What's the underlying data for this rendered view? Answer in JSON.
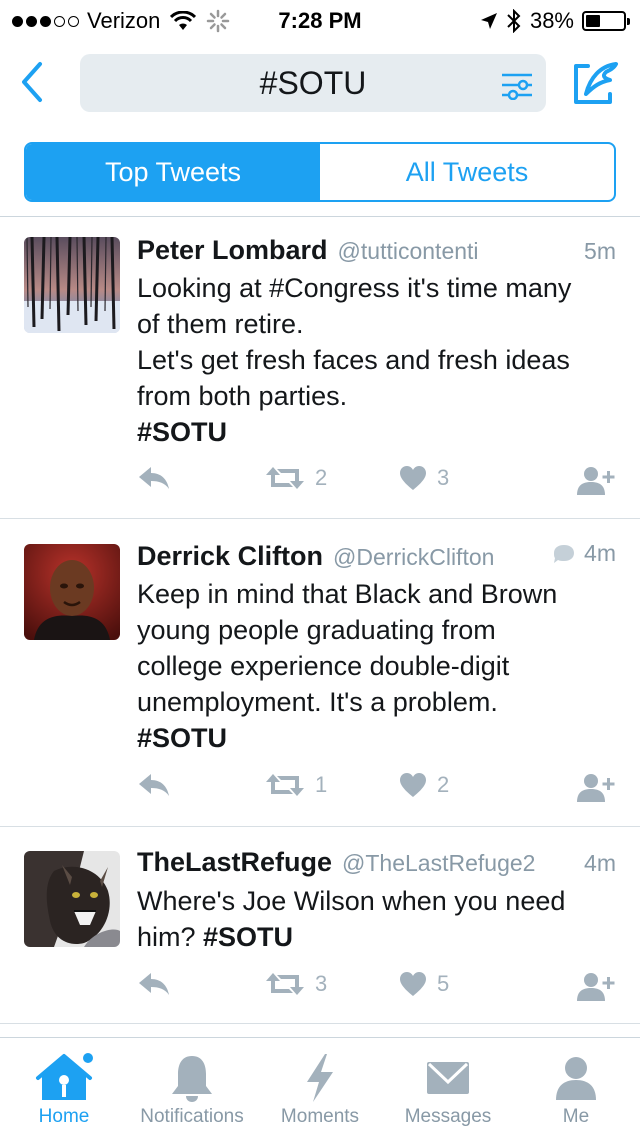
{
  "status_bar": {
    "carrier": "Verizon",
    "time": "7:28 PM",
    "battery": "38%",
    "battery_level": 0.38
  },
  "search": {
    "query": "#SOTU"
  },
  "segments": [
    {
      "label": "Top Tweets",
      "active": true
    },
    {
      "label": "All Tweets",
      "active": false
    }
  ],
  "tweets": [
    {
      "name": "Peter Lombard",
      "handle": "@tutticontenti",
      "time": "5m",
      "lines": [
        "Looking at #Congress it's time many",
        "of them retire.",
        "Let's get fresh faces and fresh ideas",
        "from both parties."
      ],
      "hashtag": "#SOTU",
      "retweets": "2",
      "likes": "3"
    },
    {
      "name": "Derrick Clifton",
      "handle": "@DerrickClifton",
      "time": "4m",
      "lines": [
        "Keep in mind that Black and Brown",
        "young people graduating from",
        "college experience double-digit",
        "unemployment. It's a problem."
      ],
      "hashtag": "#SOTU",
      "retweets": "1",
      "likes": "2"
    },
    {
      "name": "TheLastRefuge",
      "handle": "@TheLastRefuge2",
      "time": "4m",
      "lines": [
        "Where's Joe Wilson when you need"
      ],
      "last_line_prefix": "him? ",
      "hashtag": "#SOTU",
      "retweets": "3",
      "likes": "5"
    }
  ],
  "tabbar": [
    {
      "label": "Home",
      "icon": "home-icon",
      "active": true
    },
    {
      "label": "Notifications",
      "icon": "bell-icon",
      "active": false
    },
    {
      "label": "Moments",
      "icon": "lightning-icon",
      "active": false
    },
    {
      "label": "Messages",
      "icon": "envelope-icon",
      "active": false
    },
    {
      "label": "Me",
      "icon": "person-icon",
      "active": false
    }
  ],
  "colors": {
    "accent": "#1da1f2",
    "secondary_text": "#8899a6",
    "action_gray": "#a3b1bc"
  }
}
